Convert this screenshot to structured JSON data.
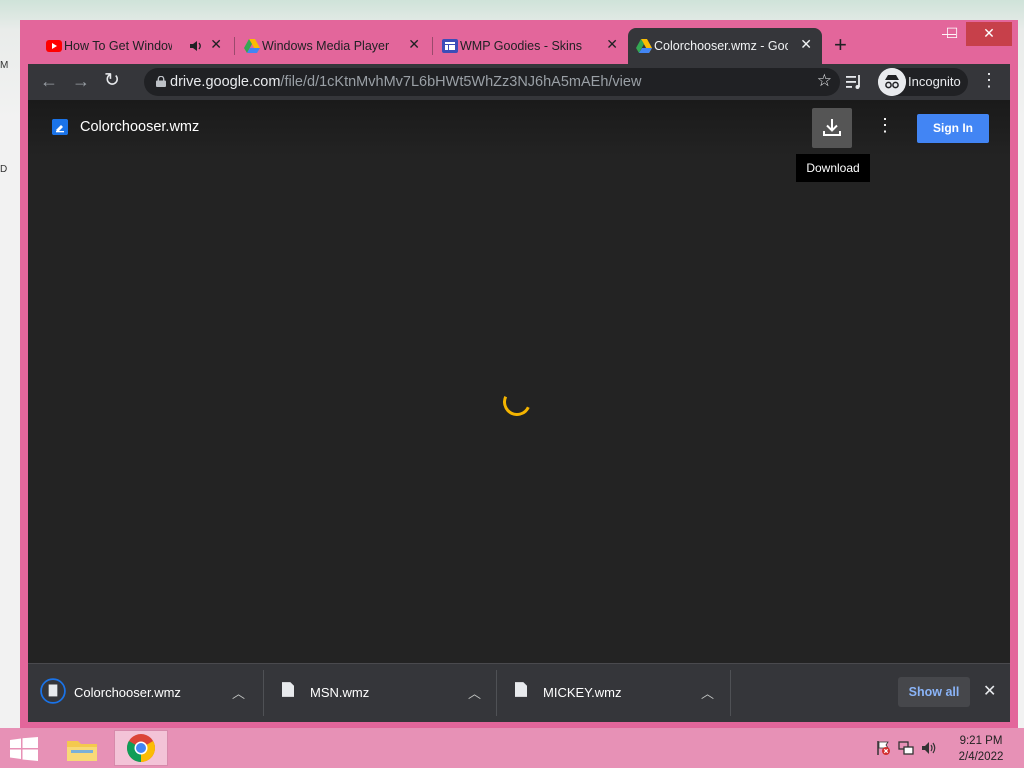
{
  "desktop": {
    "edge_letters": [
      "M",
      "D"
    ]
  },
  "tabs": [
    {
      "title": "How To Get Windows",
      "icon": "youtube-icon",
      "has_audio": true
    },
    {
      "title": "Windows Media Player &",
      "icon": "google-drive-icon"
    },
    {
      "title": "WMP Goodies - Skins",
      "icon": "website-icon"
    },
    {
      "title": "Colorchooser.wmz - Goo",
      "icon": "google-drive-icon",
      "active": true
    }
  ],
  "window_controls": {
    "minimize": "—",
    "maximize": "☐",
    "close": "✕"
  },
  "toolbar": {
    "url_domain": "drive.google.com",
    "url_path": "/file/d/1cKtnMvhMv7L6bHWt5WhZz3NJ6hA5mAEh/view",
    "profile_label": "Incognito"
  },
  "viewer": {
    "file_name": "Colorchooser.wmz",
    "download_tooltip": "Download",
    "sign_in_label": "Sign In"
  },
  "downloads": [
    {
      "name": "Colorchooser.wmz",
      "in_progress": true
    },
    {
      "name": "MSN.wmz"
    },
    {
      "name": "MICKEY.wmz"
    }
  ],
  "shelf": {
    "show_all_label": "Show all"
  },
  "taskbar": {
    "time": "9:21 PM",
    "date": "2/4/2022"
  },
  "colors": {
    "window_frame": "#e3669b",
    "taskbar": "#e791b6",
    "chrome_toolbar": "#35363a",
    "viewer_bg": "#232323",
    "sign_in_button": "#4285f4",
    "spinner": "#f4b400"
  }
}
